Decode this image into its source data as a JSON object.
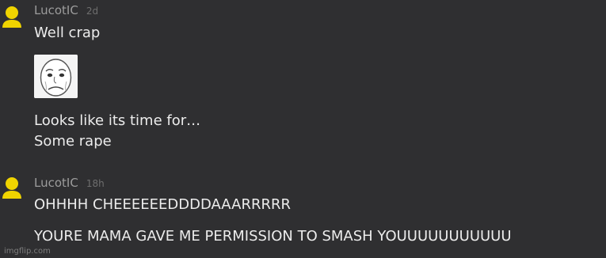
{
  "comments": [
    {
      "username": "LucotIC",
      "time": "2d",
      "lines": [
        "Well crap",
        "Looks like its time for…",
        "Some rape"
      ],
      "image": "okay-rage-face-meme"
    },
    {
      "username": "LucotIC",
      "time": "18h",
      "lines": [
        "OHHHH CHEEEEEEDDDDAAARRRRR",
        "YOURE MAMA GAVE ME PERMISSION TO SMASH YOUUUUUUUUUUU"
      ]
    }
  ],
  "watermark": "imgflip.com",
  "colors": {
    "background": "#2f2f31",
    "avatar": "#f0d400",
    "username": "#9c9c9c",
    "text": "#ececec"
  }
}
